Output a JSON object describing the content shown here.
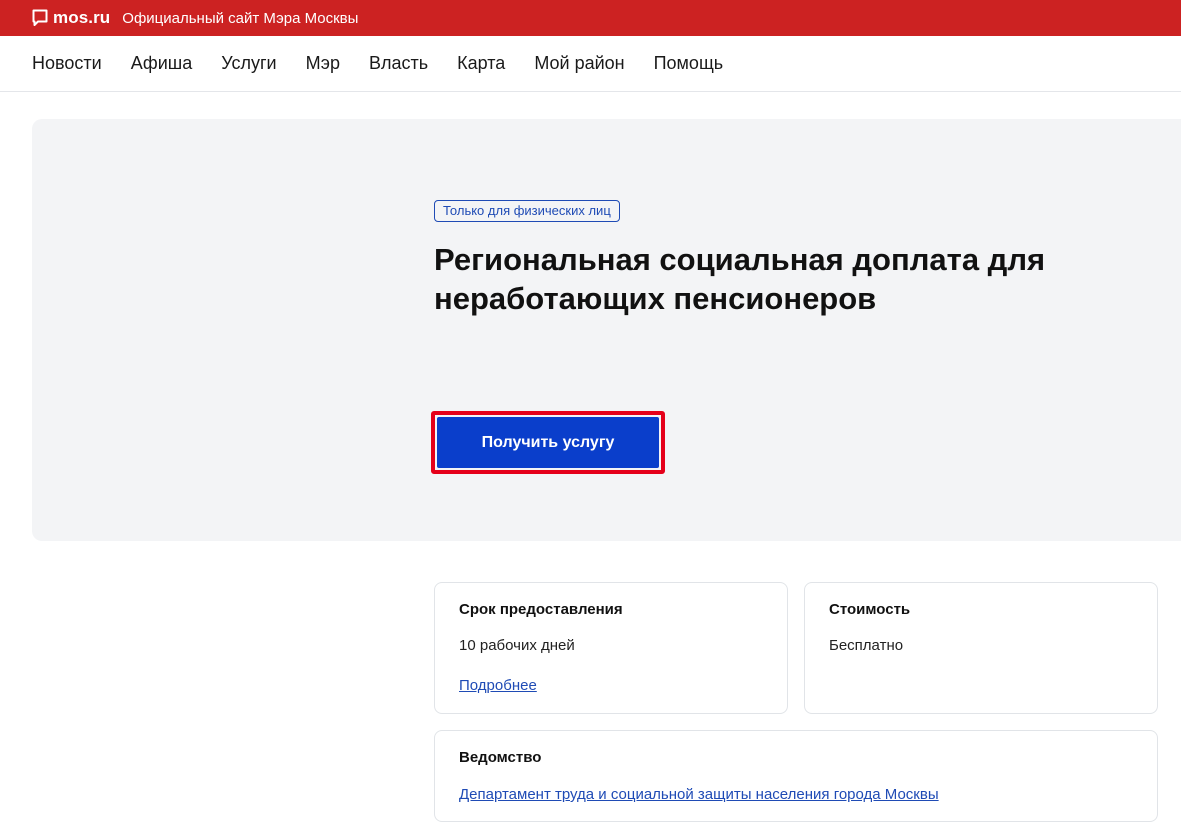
{
  "header": {
    "logo_text": "mos.ru",
    "subtitle": "Официальный сайт Мэра Москвы",
    "logo_icon": "speech-bubble-icon",
    "brand_color": "#cc2222"
  },
  "nav": {
    "items": [
      "Новости",
      "Афиша",
      "Услуги",
      "Мэр",
      "Власть",
      "Карта",
      "Мой район",
      "Помощь"
    ]
  },
  "hero": {
    "badge": "Только для физических лиц",
    "title": "Региональная социальная доплата для неработающих пенсионеров",
    "cta_label": "Получить услугу",
    "cta_color": "#0a3ecb",
    "highlight_color": "#e5001a"
  },
  "cards": {
    "term": {
      "title": "Срок предоставления",
      "value": "10 рабочих дней",
      "link": "Подробнее"
    },
    "cost": {
      "title": "Стоимость",
      "value": "Бесплатно"
    },
    "department": {
      "title": "Ведомство",
      "link": "Департамент труда и социальной защиты населения города Москвы"
    }
  }
}
